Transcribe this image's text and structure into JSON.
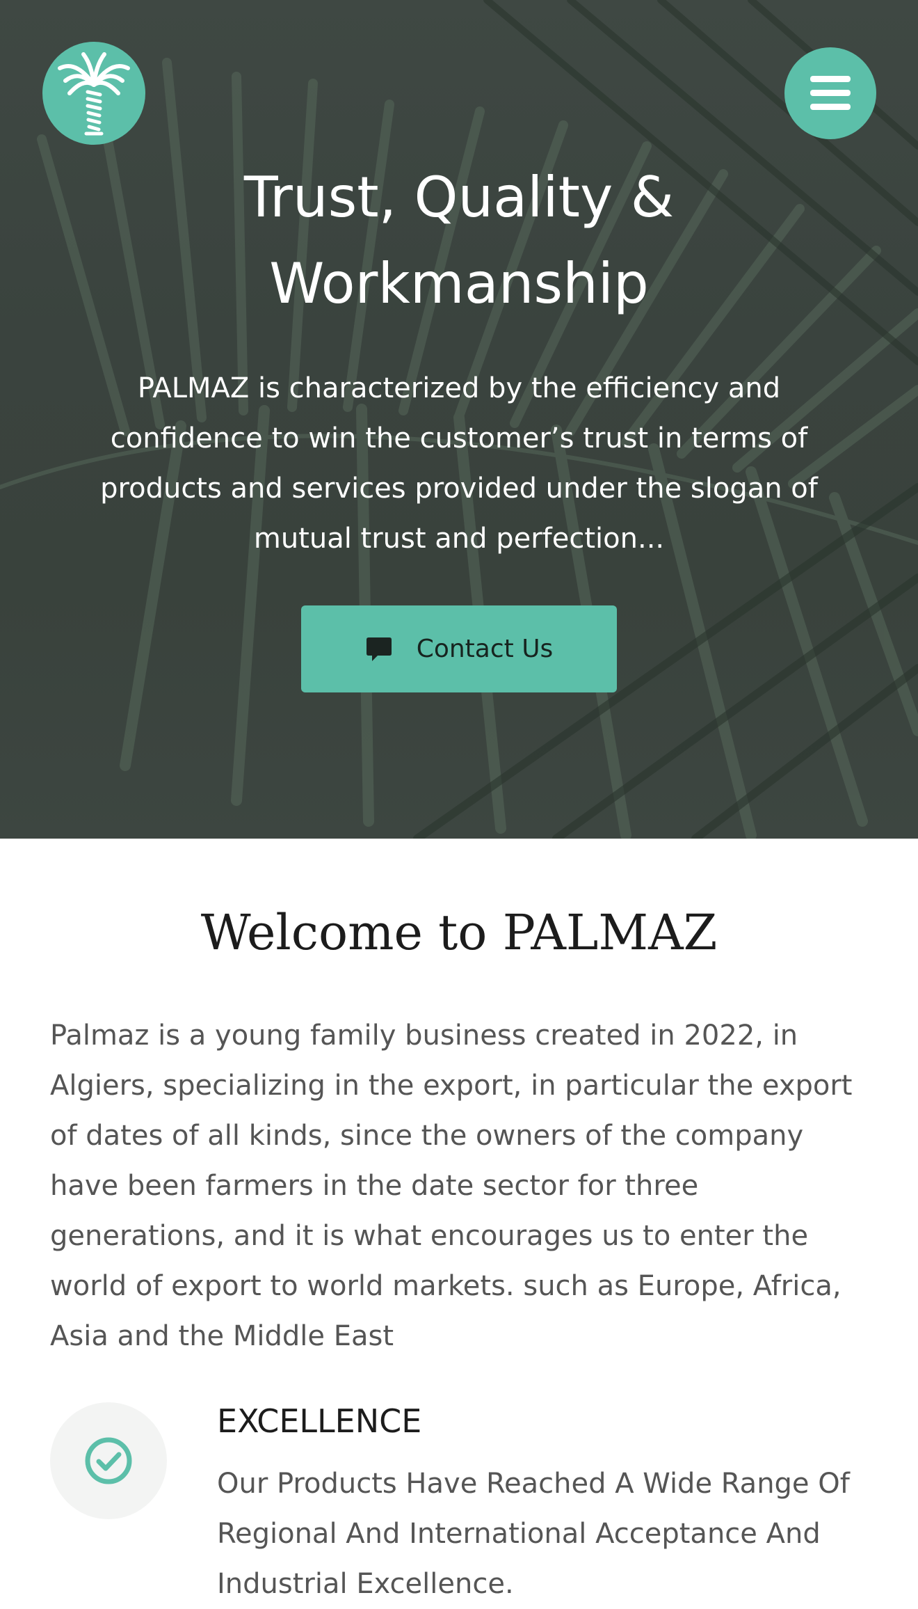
{
  "colors": {
    "accent": "#5cbfa9",
    "hero_overlay": "#3a433e",
    "heading": "#1c1c1c",
    "body_text": "#555555",
    "icon_bg": "#f3f4f3"
  },
  "header": {
    "logo_icon": "palm-tree-logo-icon",
    "menu_icon": "hamburger-menu-icon"
  },
  "hero": {
    "title_line1": "Trust, Quality &",
    "title_line2": "Workmanship",
    "text_line1": "PALMAZ is characterized by the efficiency and",
    "text_line2": "confidence to win the customer’s trust in terms of",
    "text_line3": "products and services provided under the slogan of",
    "text_line4": "mutual trust and perfection...",
    "cta_icon": "chat-bubble-icon",
    "cta_label": "Contact Us"
  },
  "welcome": {
    "title": "Welcome to PALMAZ",
    "lines": [
      "Palmaz is a young family business created in 2022, in",
      "Algiers, specializing in the export, in particular the export",
      "of dates of all kinds, since the owners of the company",
      "have been farmers in the date sector for three",
      "generations, and it is what encourages us to enter the",
      "world of export to world markets. such as Europe, Africa,",
      "Asia and the Middle East"
    ]
  },
  "feature": {
    "icon": "check-circle-icon",
    "title": "EXCELLENCE",
    "lines": [
      "Our Products Have Reached A Wide Range Of",
      "Regional And International Acceptance And",
      "Industrial Excellence."
    ]
  }
}
